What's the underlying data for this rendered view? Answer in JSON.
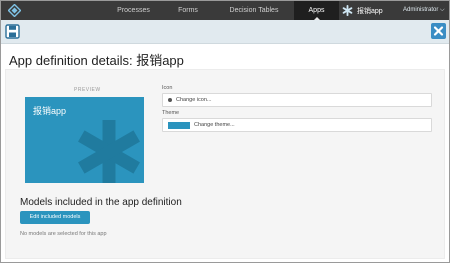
{
  "navbar": {
    "items": [
      {
        "label": "Processes"
      },
      {
        "label": "Forms"
      },
      {
        "label": "Decision Tables"
      },
      {
        "label": "Apps"
      }
    ],
    "current_app": "报销app",
    "user": "Administrator ⌵"
  },
  "page": {
    "title": "App definition details: 报销app"
  },
  "preview": {
    "label": "PREVIEW",
    "app_name": "报销app",
    "icon": "asterisk-icon"
  },
  "icon_field": {
    "label": "Icon",
    "button_text": "Change icon..."
  },
  "theme_field": {
    "label": "Theme",
    "button_text": "Change theme..."
  },
  "models": {
    "title": "Models included in the app definition",
    "edit_button": "Edit included models",
    "empty_text": "No models are selected for this app"
  },
  "colors": {
    "navbar": "#3a3a3a",
    "accent": "#2b94be",
    "toolbar": "#e1eaef",
    "close": "#3a8dc4"
  }
}
